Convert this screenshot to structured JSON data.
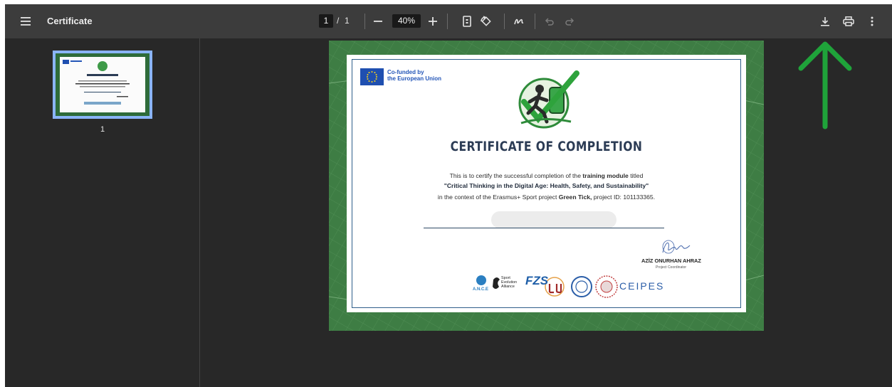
{
  "toolbar": {
    "title": "Certificate",
    "page_current": "1",
    "page_separator": "/",
    "page_total": "1",
    "zoom": "40%"
  },
  "sidebar": {
    "thumbnail_label": "1"
  },
  "certificate": {
    "eu_line1": "Co-funded by",
    "eu_line2": "the European Union",
    "heading": "CERTIFICATE OF COMPLETION",
    "body_l1_pre": "This is to certify the successful completion of the ",
    "body_l1_bold": "training module",
    "body_l1_post": " titled",
    "body_l2": "\"Critical Thinking in the Digital Age: Health, Safety, and Sustainability\"",
    "body_l3_pre": "in the context of the Erasmus+ Sport project ",
    "body_l3_bold": "Green Tick,",
    "body_l3_post": " project  ID: 101133365.",
    "coordinator_name": "AZİZ ONURHAN AHRAZ",
    "coordinator_role": "Project Coordinator",
    "logo_ance": "A.N.C.E",
    "logo_sea_1": "Sport",
    "logo_sea_2": "Evolution",
    "logo_sea_3": "Alliance",
    "logo_fzs": "FZS",
    "logo_ceipes": "CEIPES"
  },
  "colors": {
    "toolbar_bg": "#3c3c3c",
    "viewer_bg": "#282828",
    "thumb_highlight": "#8ab4f8",
    "cert_frame_green": "#3e7d44",
    "heading_color": "#2c3c55",
    "eu_blue": "#1f4fb0",
    "annotation_arrow": "#1fa33a"
  }
}
